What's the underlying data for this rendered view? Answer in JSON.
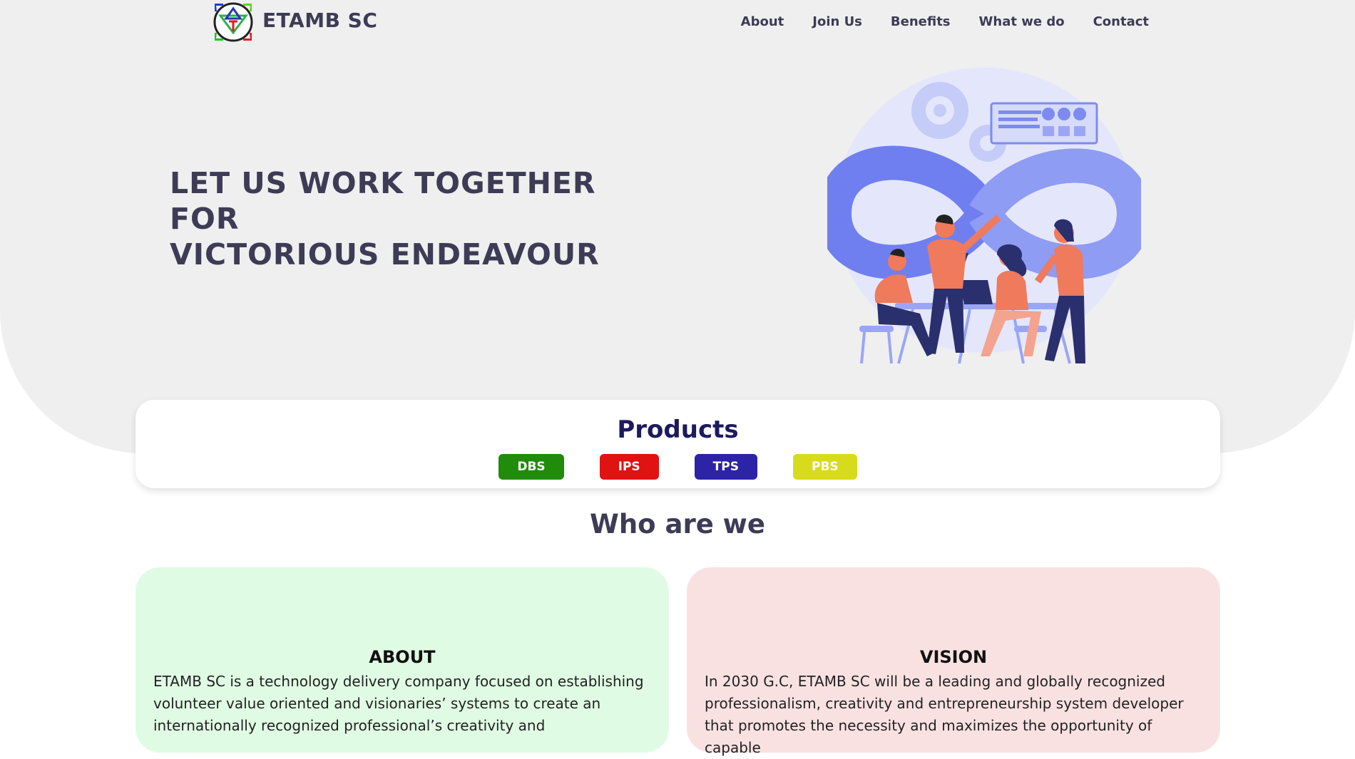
{
  "brand": {
    "name": "ETAMB SC"
  },
  "nav": {
    "items": [
      {
        "label": "About"
      },
      {
        "label": "Join Us"
      },
      {
        "label": "Benefits"
      },
      {
        "label": "What we do"
      },
      {
        "label": "Contact"
      }
    ]
  },
  "hero": {
    "lines": [
      "LET US WORK TOGETHER",
      "FOR",
      "VICTORIOUS ENDEAVOUR"
    ]
  },
  "products": {
    "title": "Products",
    "items": [
      {
        "label": "DBS",
        "color": "#218b0b"
      },
      {
        "label": "IPS",
        "color": "#e01212"
      },
      {
        "label": "TPS",
        "color": "#2c23a6"
      },
      {
        "label": "PBS",
        "color": "#d8db1b"
      }
    ]
  },
  "who": {
    "title": "Who are we",
    "about": {
      "title": "ABOUT",
      "text": "ETAMB SC is a technology delivery company focused on establishing volunteer value oriented and visionaries’ systems to create an internationally recognized professional’s creativity and"
    },
    "vision": {
      "title": "VISION",
      "text": "In 2030 G.C, ETAMB SC will be a leading and globally recognized professionalism, creativity and entrepreneurship system developer that promotes the necessity and maximizes the opportunity of capable"
    }
  },
  "colors": {
    "hero_bg": "#efefef",
    "text_dark": "#3d3b55",
    "products_title": "#1d1a5e",
    "about_card": "#e0fbe3",
    "vision_card": "#f9e1e2",
    "illustration_blue": "#6f7ff0",
    "illustration_orange": "#ef7a5c"
  }
}
